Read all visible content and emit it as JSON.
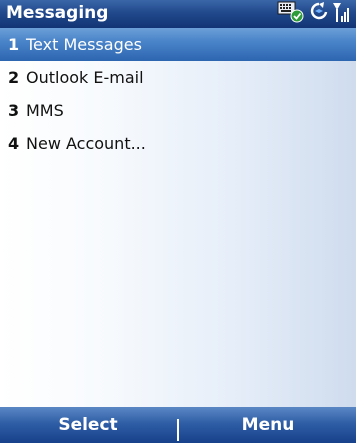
{
  "title_bar": {
    "title": "Messaging",
    "icons": [
      "keyboard-check-icon",
      "sync-icon",
      "signal-icon"
    ]
  },
  "menu": {
    "selected_index": 0,
    "items": [
      {
        "number": "1",
        "label": "Text Messages"
      },
      {
        "number": "2",
        "label": "Outlook E-mail"
      },
      {
        "number": "3",
        "label": "MMS"
      },
      {
        "number": "4",
        "label": "New Account..."
      }
    ]
  },
  "softkeys": {
    "left": "Select",
    "right": "Menu"
  },
  "colors": {
    "title_bar": "#21498c",
    "selection": "#4a84c9",
    "softkey_bar": "#2f5ea6"
  }
}
